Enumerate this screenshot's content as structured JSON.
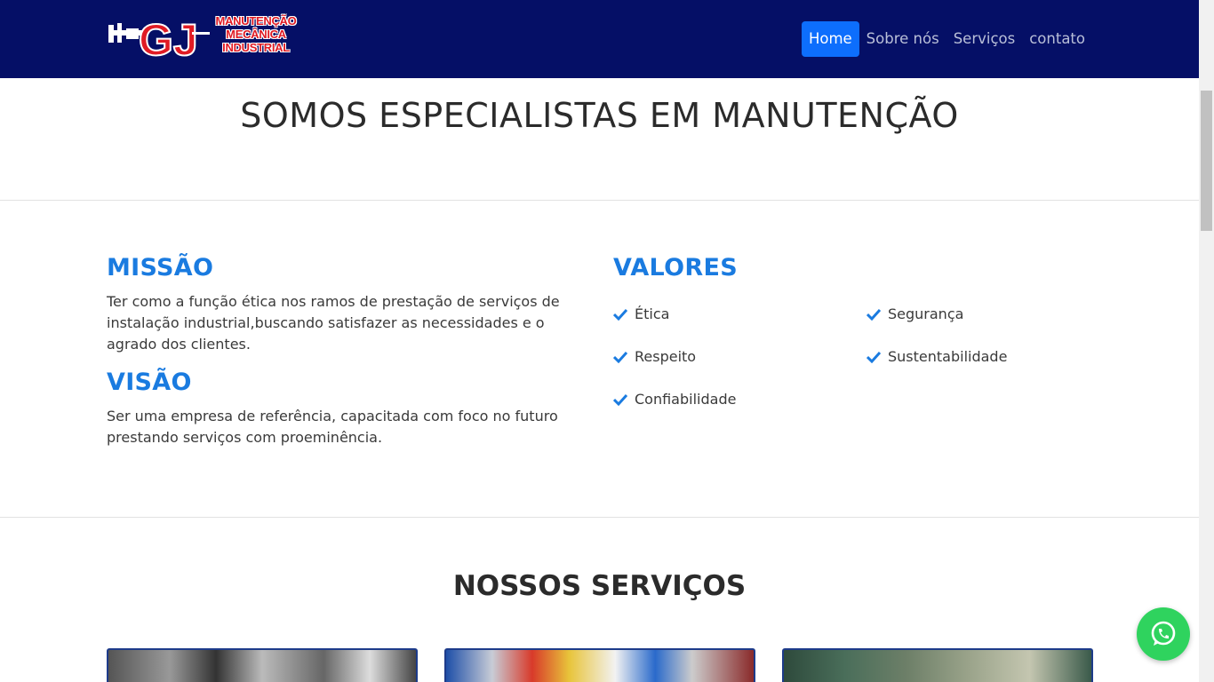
{
  "brand": {
    "initials": "GJ",
    "logo_lines": [
      "MANUTENÇÃO",
      "MECÂNICA",
      "INDUSTRIAL"
    ]
  },
  "nav": {
    "items": [
      {
        "label": "Home",
        "active": true
      },
      {
        "label": "Sobre nós",
        "active": false
      },
      {
        "label": "Serviços",
        "active": false
      },
      {
        "label": "contato",
        "active": false
      }
    ]
  },
  "hero": {
    "title": "SOMOS ESPECIALISTAS EM MANUTENÇÃO"
  },
  "mission": {
    "heading": "MISSÃO",
    "text": "Ter como a função ética nos ramos de prestação de serviços de instalação industrial,buscando satisfazer as necessidades e o agrado dos clientes."
  },
  "vision": {
    "heading": "VISÃO",
    "text": "Ser uma empresa de referência, capacitada com foco no futuro prestando serviços com proeminência."
  },
  "values": {
    "heading": "VALORES",
    "items": [
      "Ética",
      "Segurança",
      "Respeito",
      "Sustentabilidade",
      "Confiabilidade"
    ]
  },
  "services": {
    "title": "NOSSOS SERVIÇOS"
  },
  "colors": {
    "navbar": "#050f66",
    "accent": "#0d6efd",
    "heading_blue": "#1a7be0",
    "whatsapp": "#2fd35e"
  }
}
